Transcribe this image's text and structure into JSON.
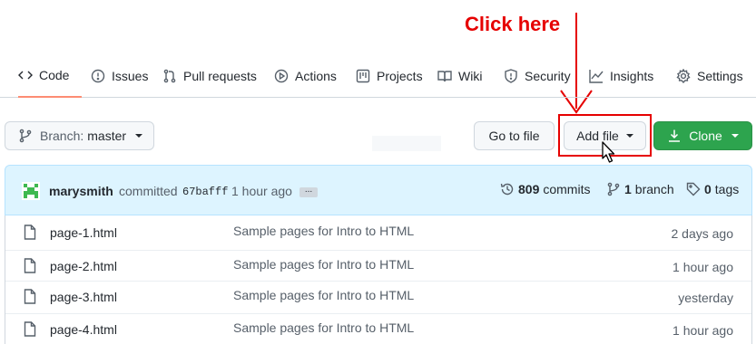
{
  "annotation": {
    "text": "Click here",
    "color": "#e60000"
  },
  "tabs": [
    {
      "label": "Code",
      "icon": "code-icon",
      "active": true
    },
    {
      "label": "Issues",
      "icon": "issue-icon"
    },
    {
      "label": "Pull requests",
      "icon": "pull-request-icon"
    },
    {
      "label": "Actions",
      "icon": "play-icon"
    },
    {
      "label": "Projects",
      "icon": "project-icon"
    },
    {
      "label": "Wiki",
      "icon": "book-icon"
    },
    {
      "label": "Security",
      "icon": "shield-icon"
    },
    {
      "label": "Insights",
      "icon": "graph-icon"
    },
    {
      "label": "Settings",
      "icon": "gear-icon"
    }
  ],
  "toolbar": {
    "branch_label": "Branch:",
    "branch_name": "master",
    "goto_file": "Go to file",
    "add_file": "Add file",
    "clone": "Clone"
  },
  "commit": {
    "user": "marysmith",
    "verb": "committed",
    "sha": "67bafff",
    "time": "1 hour ago",
    "ellipsis": "...",
    "commits_count": "809",
    "commits_label": "commits",
    "branch_count": "1",
    "branch_label": "branch",
    "tags_count": "0",
    "tags_label": "tags"
  },
  "files": [
    {
      "name": "page-1.html",
      "message": "Sample pages for Intro to HTML",
      "time": "2 days ago"
    },
    {
      "name": "page-2.html",
      "message": "Sample pages for Intro to HTML",
      "time": "1 hour ago"
    },
    {
      "name": "page-3.html",
      "message": "Sample pages for Intro to HTML",
      "time": "yesterday"
    },
    {
      "name": "page-4.html",
      "message": "Sample pages for Intro to HTML",
      "time": "1 hour ago"
    }
  ],
  "colors": {
    "accent_green": "#2da44e",
    "active_tab_underline": "#fd8c73",
    "annotation_red": "#e60000"
  }
}
